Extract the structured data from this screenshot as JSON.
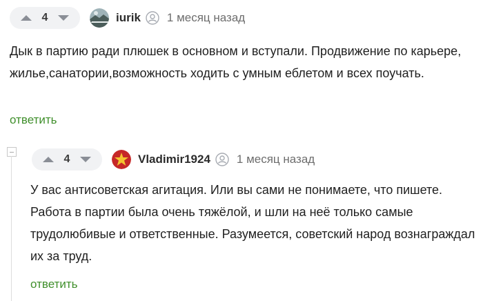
{
  "comments": [
    {
      "rating": "4",
      "author": "iurik",
      "time": "1 месяц назад",
      "text": "Дык в партию ради плюшек в основном и вступали. Продвижение по карьере, жилье,санатории,возможность ходить с умным еблетом и всех поучать.",
      "reply_label": "ответить",
      "avatar_icon": "landscape-avatar"
    },
    {
      "rating": "4",
      "author": "Vladimir1924",
      "time": "1 месяц назад",
      "text": "У вас антисоветская агитация. Или вы сами не понимаете, что пишете. Работа в партии была очень тяжёлой, и шли на неё только самые трудолюбивые и ответственные. Разумеется, советский народ вознаграждал их за труд.",
      "reply_label": "ответить",
      "avatar_icon": "red-star-avatar"
    }
  ],
  "colors": {
    "reply": "#3f8f2b",
    "vote_bg": "#f1f2f4",
    "star_bg": "#c62828"
  }
}
